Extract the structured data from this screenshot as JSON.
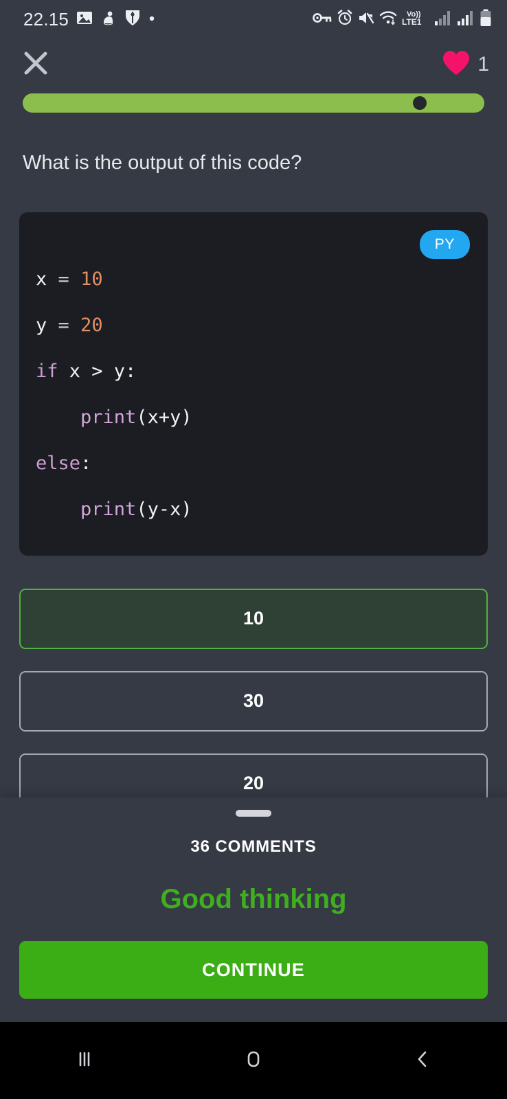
{
  "status_bar": {
    "time": "22.15",
    "left_icons": [
      "image-icon",
      "app-notification-icon",
      "shield-icon",
      "dot-icon"
    ],
    "right_icons": [
      "vpn-key-icon",
      "alarm-icon",
      "mute-icon",
      "wifi-icon",
      "volte-icon",
      "signal-bars-1-icon",
      "signal-bars-2-icon",
      "battery-icon"
    ],
    "volte_label_top": "Vo))",
    "volte_label_bottom": "LTE1"
  },
  "top_bar": {
    "close_icon": "close-icon",
    "heart_icon": "heart-icon",
    "heart_count": "1",
    "heart_color": "#f5136a"
  },
  "progress": {
    "percent": 86,
    "fill_color": "#8cbe4d",
    "dot_color": "#26282e"
  },
  "question": {
    "text": "What is the output of this code?"
  },
  "code": {
    "language_badge": "PY",
    "badge_color": "#22a7f0",
    "lines": [
      {
        "tokens": [
          {
            "t": "x",
            "c": "var"
          },
          {
            "t": " ",
            "c": "plain"
          },
          {
            "t": "=",
            "c": "op"
          },
          {
            "t": " ",
            "c": "plain"
          },
          {
            "t": "10",
            "c": "num"
          }
        ]
      },
      {
        "tokens": [
          {
            "t": "y",
            "c": "var"
          },
          {
            "t": " ",
            "c": "plain"
          },
          {
            "t": "=",
            "c": "op"
          },
          {
            "t": " ",
            "c": "plain"
          },
          {
            "t": "20",
            "c": "num"
          }
        ]
      },
      {
        "tokens": [
          {
            "t": "if",
            "c": "kw"
          },
          {
            "t": " x > y:",
            "c": "var"
          }
        ]
      },
      {
        "tokens": [
          {
            "t": "    ",
            "c": "plain"
          },
          {
            "t": "print",
            "c": "fn"
          },
          {
            "t": "(x+y)",
            "c": "var"
          }
        ]
      },
      {
        "tokens": [
          {
            "t": "else",
            "c": "kw"
          },
          {
            "t": ":",
            "c": "var"
          }
        ]
      },
      {
        "tokens": [
          {
            "t": "    ",
            "c": "plain"
          },
          {
            "t": "print",
            "c": "fn"
          },
          {
            "t": "(y-x)",
            "c": "var"
          }
        ]
      }
    ],
    "plain_text": "x = 10\ny = 20\nif x > y:\n    print(x+y)\nelse:\n    print(y-x)"
  },
  "answers": {
    "options": [
      {
        "label": "10",
        "selected": true
      },
      {
        "label": "30",
        "selected": false
      },
      {
        "label": "20",
        "selected": false
      }
    ],
    "selected_color": "#52b043",
    "selected_fill": "#2f4034"
  },
  "bottom_sheet": {
    "handle": "drag-handle",
    "comments_label": "36 COMMENTS",
    "feedback_text": "Good thinking",
    "feedback_color": "#3fae1f",
    "continue_label": "CONTINUE",
    "continue_color": "#3cae15"
  },
  "nav_bar": {
    "recents_icon": "recent-apps-icon",
    "home_icon": "home-icon",
    "back_icon": "back-icon"
  }
}
